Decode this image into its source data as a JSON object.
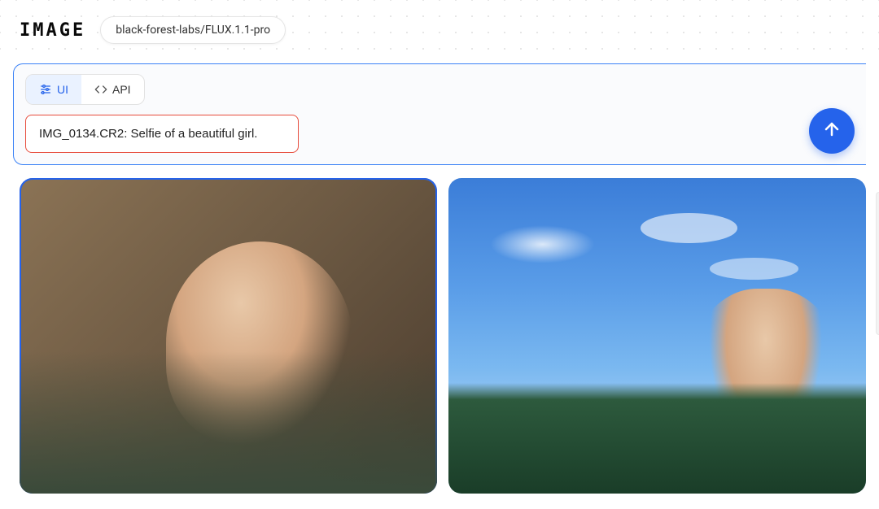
{
  "header": {
    "title": "IMAGE",
    "model": "black-forest-labs/FLUX.1.1-pro"
  },
  "tabs": {
    "ui_label": "UI",
    "api_label": "API",
    "active": "ui"
  },
  "prompt": {
    "value": "IMG_0134.CR2: Selfie of a beautiful girl."
  },
  "colors": {
    "accent": "#2563eb",
    "highlight_border": "#e74c3c",
    "tab_active_bg": "#eaf2ff"
  },
  "icons": {
    "sliders": "sliders-icon",
    "code": "code-icon",
    "arrow_up": "arrow-up-icon"
  },
  "gallery": {
    "items": [
      {
        "scene": "indoor-portrait",
        "selected": true
      },
      {
        "scene": "outdoor-portrait",
        "selected": false
      }
    ]
  }
}
